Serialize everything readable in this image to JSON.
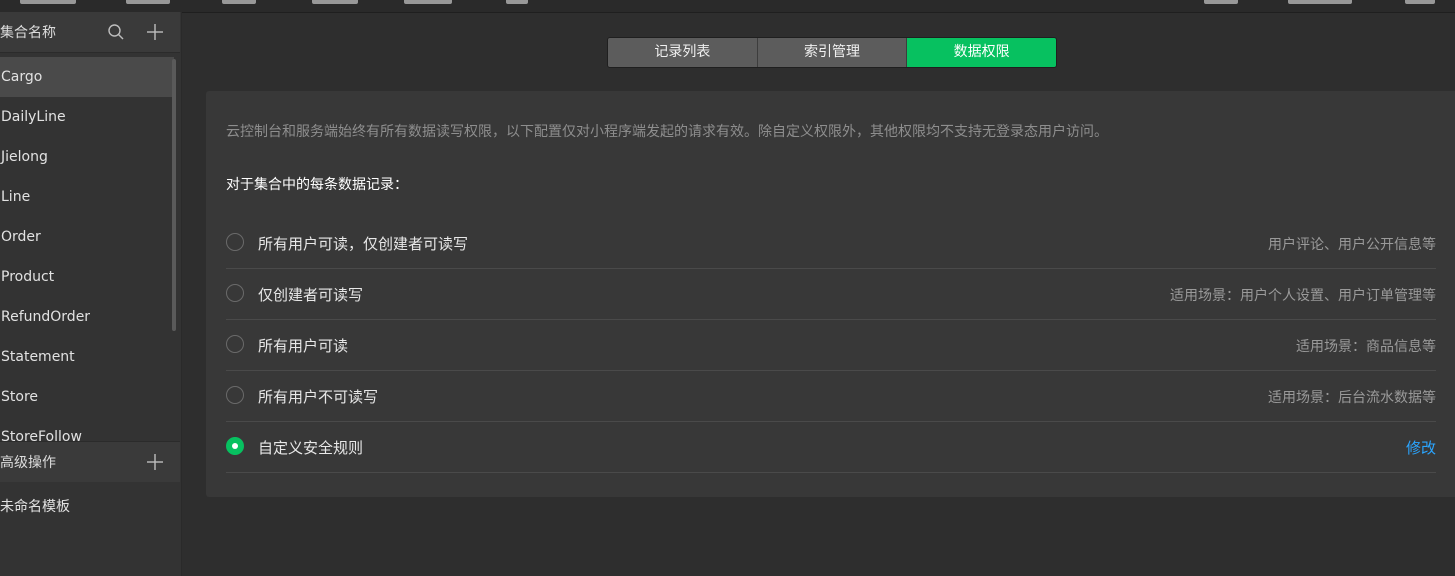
{
  "sidebar": {
    "header_title": "集合名称",
    "items": [
      "Cargo",
      "DailyLine",
      "Jielong",
      "Line",
      "Order",
      "Product",
      "RefundOrder",
      "Statement",
      "Store",
      "StoreFollow"
    ],
    "active_index": 0,
    "advanced_title": "高级操作",
    "advanced_items": [
      "未命名模板"
    ]
  },
  "icons": {
    "search": "search-icon",
    "add": "plus-icon",
    "advanced_add": "plus-icon"
  },
  "tabs": [
    {
      "label": "记录列表",
      "active": false
    },
    {
      "label": "索引管理",
      "active": false
    },
    {
      "label": "数据权限",
      "active": true
    }
  ],
  "panel": {
    "notice": "云控制台和服务端始终有所有数据读写权限，以下配置仅对小程序端发起的请求有效。除自定义权限外，其他权限均不支持无登录态用户访问。",
    "heading": "对于集合中的每条数据记录：",
    "options": [
      {
        "label": "所有用户可读，仅创建者可读写",
        "desc": "用户评论、用户公开信息等",
        "checked": false
      },
      {
        "label": "仅创建者可读写",
        "desc": "适用场景：用户个人设置、用户订单管理等",
        "checked": false
      },
      {
        "label": "所有用户可读",
        "desc": "适用场景：商品信息等",
        "checked": false
      },
      {
        "label": "所有用户不可读写",
        "desc": "适用场景：后台流水数据等",
        "checked": false
      },
      {
        "label": "自定义安全规则",
        "link": "修改",
        "checked": true
      }
    ]
  },
  "colors": {
    "accent": "#07c160",
    "link": "#2aa5ff",
    "background": "#2e2e2e",
    "panel": "#383838"
  }
}
